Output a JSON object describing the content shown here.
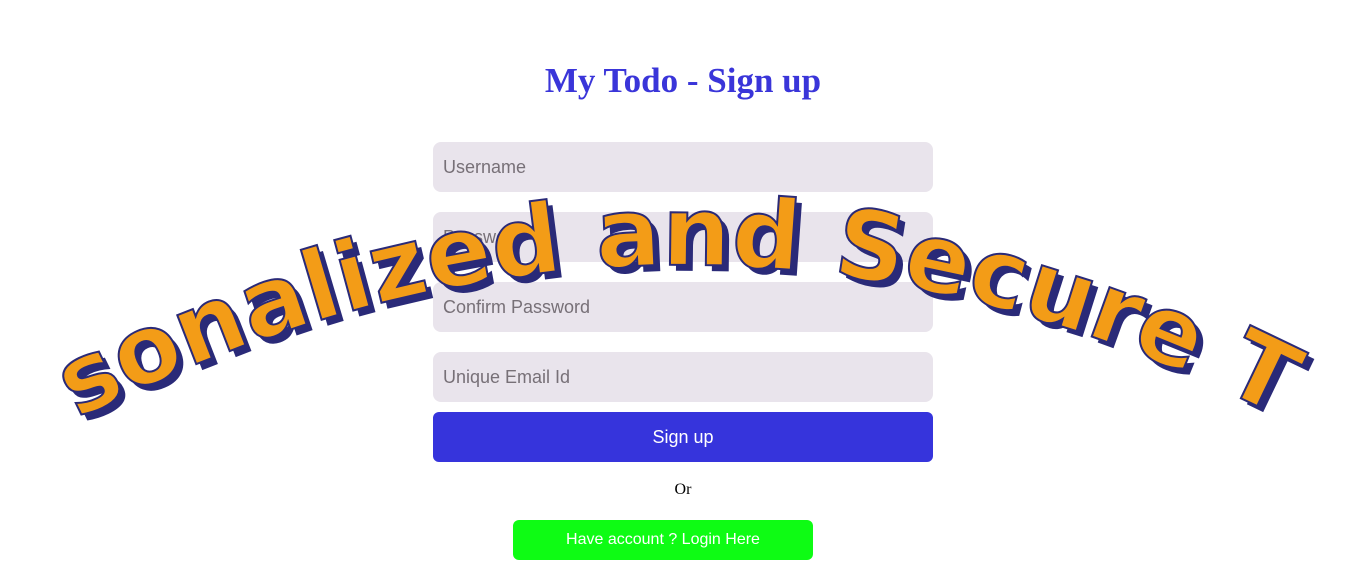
{
  "header": {
    "title": "My Todo - Sign up"
  },
  "form": {
    "username_placeholder": "Username",
    "password_placeholder": "Password",
    "confirm_password_placeholder": "Confirm Password",
    "email_placeholder": "Unique Email Id",
    "signup_label": "Sign up",
    "or_label": "Or",
    "login_label": "Have account ? Login Here"
  },
  "banner": {
    "text": "Personalized and Secure Todo"
  },
  "colors": {
    "title": "#3a35d9",
    "signup_button": "#3634dc",
    "login_button": "#0efc14",
    "field_background": "#e9e4ec",
    "banner_fill": "#f39c17",
    "banner_outline": "#2a2a78"
  }
}
